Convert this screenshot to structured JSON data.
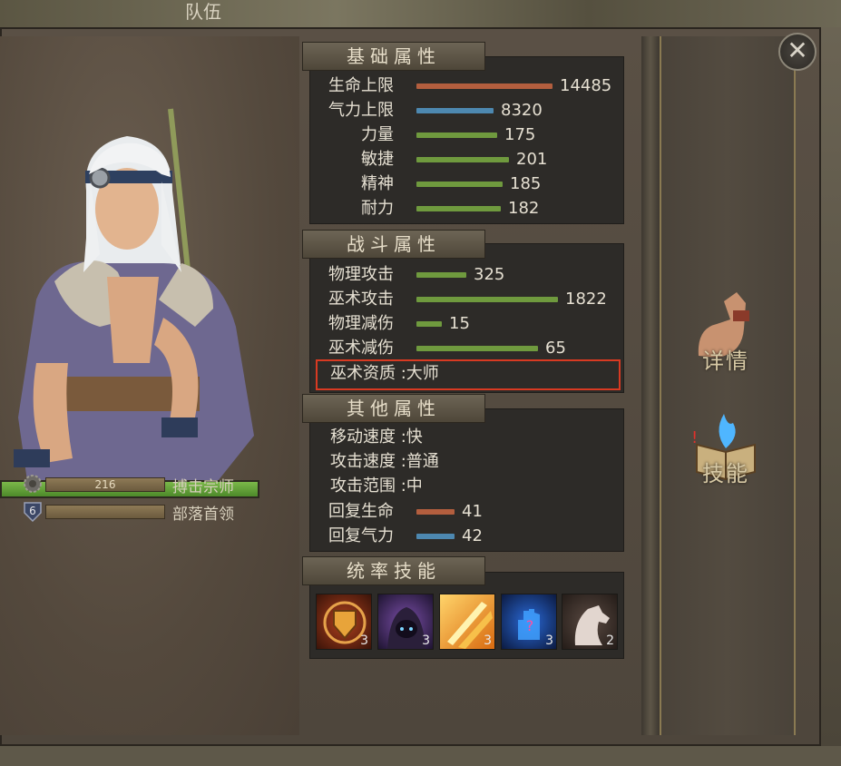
{
  "header": {
    "title": "队伍"
  },
  "character": {
    "level1_value": "216",
    "level1_title": "搏击宗师",
    "level2_badge": "6",
    "level2_title": "部落首领",
    "hp_fill": 1.0
  },
  "base_stats": {
    "title": "基础属性",
    "rows": [
      {
        "label": "生命上限",
        "value": "14485",
        "bar_color": "#b35e3e",
        "bar_fraction": 1.0
      },
      {
        "label": "气力上限",
        "value": "8320",
        "bar_color": "#4d88b0",
        "bar_fraction": 0.57
      },
      {
        "label": "力量",
        "value": "175",
        "bar_color": "#6f9a3e",
        "bar_fraction": 0.59
      },
      {
        "label": "敏捷",
        "value": "201",
        "bar_color": "#6f9a3e",
        "bar_fraction": 0.68
      },
      {
        "label": "精神",
        "value": "185",
        "bar_color": "#6f9a3e",
        "bar_fraction": 0.63
      },
      {
        "label": "耐力",
        "value": "182",
        "bar_color": "#6f9a3e",
        "bar_fraction": 0.62
      }
    ]
  },
  "combat_stats": {
    "title": "战斗属性",
    "rows": [
      {
        "label": "物理攻击",
        "value": "325",
        "bar_color": "#6f9a3e",
        "bar_fraction": 0.35
      },
      {
        "label": "巫术攻击",
        "value": "1822",
        "bar_color": "#6f9a3e",
        "bar_fraction": 1.0
      },
      {
        "label": "物理减伤",
        "value": "15",
        "bar_color": "#6f9a3e",
        "bar_fraction": 0.18
      },
      {
        "label": "巫术减伤",
        "value": "65",
        "bar_color": "#6f9a3e",
        "bar_fraction": 0.86
      }
    ],
    "aptitude": "巫术资质 :大师"
  },
  "other_stats": {
    "title": "其他属性",
    "text_rows": [
      "移动速度 :快",
      "攻击速度 :普通",
      "攻击范围 :中"
    ],
    "bar_rows": [
      {
        "label": "回复生命",
        "value": "41",
        "bar_color": "#b35e3e",
        "bar_fraction": 0.26
      },
      {
        "label": "回复气力",
        "value": "42",
        "bar_color": "#4d88b0",
        "bar_fraction": 0.26
      }
    ]
  },
  "command_skills": {
    "title": "统率技能",
    "slots": [
      {
        "icon": "shield-icon",
        "level": "3"
      },
      {
        "icon": "hooded-figure-icon",
        "level": "3"
      },
      {
        "icon": "slash-icon",
        "level": "3"
      },
      {
        "icon": "magic-hand-icon",
        "level": "3"
      },
      {
        "icon": "horse-icon",
        "level": "2"
      }
    ]
  },
  "side_buttons": {
    "details": "详情",
    "skills": "技能"
  },
  "close_symbol": "✕"
}
